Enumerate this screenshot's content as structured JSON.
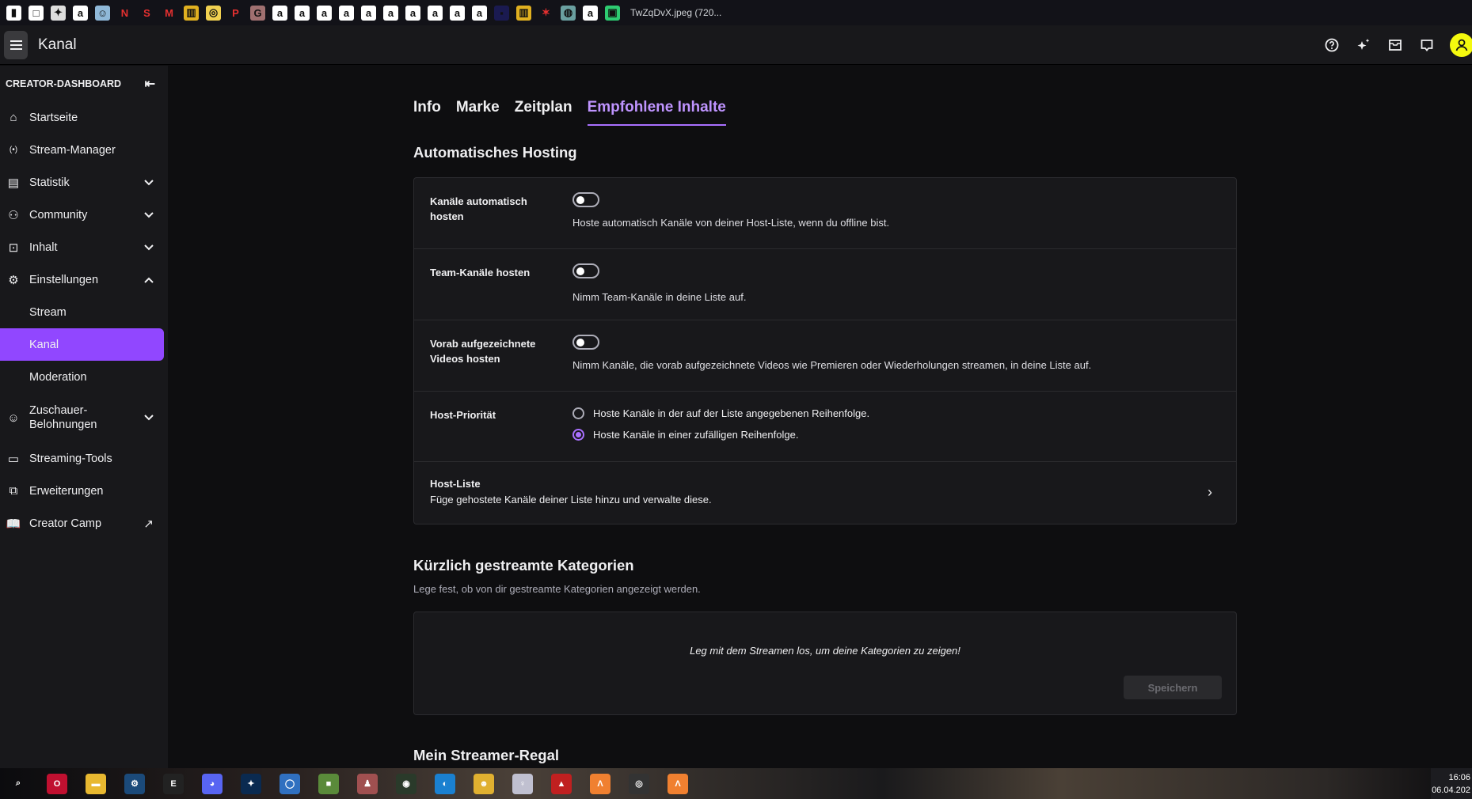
{
  "bookmarks": [
    {
      "icon": "file-icon",
      "glyph": "▮",
      "color": "#ffffff"
    },
    {
      "icon": "square-icon",
      "glyph": "□",
      "color": "#ffffff"
    },
    {
      "icon": "site-icon",
      "glyph": "✦",
      "color": "#dddddd"
    },
    {
      "icon": "amazon-icon",
      "glyph": "a",
      "color": "#ffffff"
    },
    {
      "icon": "avatar-bookmark-icon",
      "glyph": "☺",
      "color": "#8fb8d8"
    },
    {
      "icon": "netflix-icon",
      "glyph": "N",
      "color": "#121218"
    },
    {
      "icon": "sparkasse-icon",
      "glyph": "S",
      "color": "#121218"
    },
    {
      "icon": "gmail-icon",
      "glyph": "M",
      "color": "#121218"
    },
    {
      "icon": "tv-icon",
      "glyph": "▥",
      "color": "#e0b020"
    },
    {
      "icon": "coin-icon",
      "glyph": "◎",
      "color": "#f0d050"
    },
    {
      "icon": "paypal-icon",
      "glyph": "P",
      "color": "#121218"
    },
    {
      "icon": "g-icon",
      "glyph": "G",
      "color": "#a07070"
    },
    {
      "icon": "amazon-icon",
      "glyph": "a",
      "color": "#ffffff"
    },
    {
      "icon": "amazon-icon",
      "glyph": "a",
      "color": "#ffffff"
    },
    {
      "icon": "amazon-icon",
      "glyph": "a",
      "color": "#ffffff"
    },
    {
      "icon": "amazon-icon",
      "glyph": "a",
      "color": "#ffffff"
    },
    {
      "icon": "amazon-icon",
      "glyph": "a",
      "color": "#ffffff"
    },
    {
      "icon": "amazon-icon",
      "glyph": "a",
      "color": "#ffffff"
    },
    {
      "icon": "amazon-icon",
      "glyph": "a",
      "color": "#ffffff"
    },
    {
      "icon": "amazon-icon",
      "glyph": "a",
      "color": "#ffffff"
    },
    {
      "icon": "amazon-icon",
      "glyph": "a",
      "color": "#ffffff"
    },
    {
      "icon": "amazon-icon",
      "glyph": "a",
      "color": "#ffffff"
    },
    {
      "icon": "dark-site-icon",
      "glyph": "▪",
      "color": "#1a1a50"
    },
    {
      "icon": "tv-icon",
      "glyph": "▥",
      "color": "#e0b020"
    },
    {
      "icon": "star-icon",
      "glyph": "✶",
      "color": "#121218"
    },
    {
      "icon": "cat-icon",
      "glyph": "◍",
      "color": "#6aa0a0"
    },
    {
      "icon": "amazon-icon",
      "glyph": "a",
      "color": "#ffffff"
    },
    {
      "icon": "image-icon",
      "glyph": "▣",
      "color": "#2ecc71"
    }
  ],
  "bookmark_tab": "TwZqDvX.jpeg (720...",
  "header": {
    "title": "Kanal",
    "icons": [
      "help-icon",
      "sparkle-icon",
      "inbox-icon",
      "whisper-icon",
      "user-avatar-icon"
    ],
    "avatar_color": "#f4f90e"
  },
  "sidebar": {
    "title": "CREATOR-DASHBOARD",
    "items": [
      {
        "label": "Startseite",
        "icon": "home-icon"
      },
      {
        "label": "Stream-Manager",
        "icon": "broadcast-icon"
      },
      {
        "label": "Statistik",
        "icon": "chart-icon",
        "chevron": "down"
      },
      {
        "label": "Community",
        "icon": "community-icon",
        "chevron": "down"
      },
      {
        "label": "Inhalt",
        "icon": "content-icon",
        "chevron": "down"
      },
      {
        "label": "Einstellungen",
        "icon": "gear-icon",
        "chevron": "up"
      },
      {
        "label": "Stream",
        "sub": true
      },
      {
        "label": "Kanal",
        "sub": true,
        "active": true
      },
      {
        "label": "Moderation",
        "sub": true
      },
      {
        "label": "Zuschauer-\nBelohnungen",
        "icon": "smiley-icon",
        "chevron": "down"
      },
      {
        "label": "Streaming-Tools",
        "icon": "camera-icon"
      },
      {
        "label": "Erweiterungen",
        "icon": "puzzle-icon"
      },
      {
        "label": "Creator Camp",
        "icon": "book-icon",
        "external": true
      }
    ]
  },
  "tabs": [
    {
      "label": "Info"
    },
    {
      "label": "Marke"
    },
    {
      "label": "Zeitplan"
    },
    {
      "label": "Empfohlene Inhalte",
      "active": true
    }
  ],
  "hosting": {
    "title": "Automatisches Hosting",
    "rows": [
      {
        "label": "Kanäle automatisch hosten",
        "toggle": false,
        "desc": "Hoste automatisch Kanäle von deiner Host-Liste, wenn du offline bist."
      },
      {
        "label": "Team-Kanäle hosten",
        "toggle": false,
        "desc": "Nimm Team-Kanäle in deine Liste auf."
      },
      {
        "label": "Vorab aufgezeichnete Videos hosten",
        "toggle": false,
        "desc": "Nimm Kanäle, die vorab aufgezeichnete Videos wie Premieren oder Wiederholungen streamen, in deine Liste auf."
      }
    ],
    "priority": {
      "label": "Host-Priorität",
      "options": [
        "Hoste Kanäle in der auf der Liste angegebenen Reihenfolge.",
        "Hoste Kanäle in einer zufälligen Reihenfolge."
      ],
      "selected": 1
    },
    "host_list": {
      "title": "Host-Liste",
      "desc": "Füge gehostete Kanäle deiner Liste hinzu und verwalte diese."
    }
  },
  "categories": {
    "title": "Kürzlich gestreamte Kategorien",
    "subtitle": "Lege fest, ob von dir gestreamte Kategorien angezeigt werden.",
    "empty": "Leg mit dem Streamen los, um deine Kategorien zu zeigen!",
    "save": "Speichern"
  },
  "shelf": {
    "title": "Mein Streamer-Regal"
  },
  "accent": "#9147ff",
  "taskbar": {
    "icons": [
      {
        "icon": "search-icon",
        "glyph": "⌕",
        "color": "transparent"
      },
      {
        "icon": "opera-icon",
        "glyph": "O",
        "color": "#c01030"
      },
      {
        "icon": "file-explorer-icon",
        "glyph": "▬",
        "color": "#e8b830"
      },
      {
        "icon": "steam-icon",
        "glyph": "⚙",
        "color": "#1b4a7a"
      },
      {
        "icon": "epic-games-icon",
        "glyph": "E",
        "color": "#222"
      },
      {
        "icon": "discord-icon",
        "glyph": "◕",
        "color": "#5865f2"
      },
      {
        "icon": "battlenet-icon",
        "glyph": "✦",
        "color": "#0a2a50"
      },
      {
        "icon": "app-ring-icon",
        "glyph": "◯",
        "color": "#3070c0"
      },
      {
        "icon": "minecraft-icon",
        "glyph": "■",
        "color": "#5a8a3a"
      },
      {
        "icon": "app-character-icon",
        "glyph": "♟",
        "color": "#a05050"
      },
      {
        "icon": "nvidia-icon",
        "glyph": "◉",
        "color": "#2a3a2a"
      },
      {
        "icon": "app-blue-icon",
        "glyph": "◐",
        "color": "#1a80d0"
      },
      {
        "icon": "app-coin-icon",
        "glyph": "☻",
        "color": "#e0b030"
      },
      {
        "icon": "anime-app-icon",
        "glyph": "♀",
        "color": "#c0c0d0"
      },
      {
        "icon": "app-red-icon",
        "glyph": "▲",
        "color": "#c02020"
      },
      {
        "icon": "app-orange-icon",
        "glyph": "Λ",
        "color": "#f08030"
      },
      {
        "icon": "obs-icon",
        "glyph": "◎",
        "color": "#333"
      },
      {
        "icon": "app-orange-icon",
        "glyph": "Λ",
        "color": "#f08030"
      }
    ],
    "time": "16:06",
    "date": "06.04.202"
  }
}
